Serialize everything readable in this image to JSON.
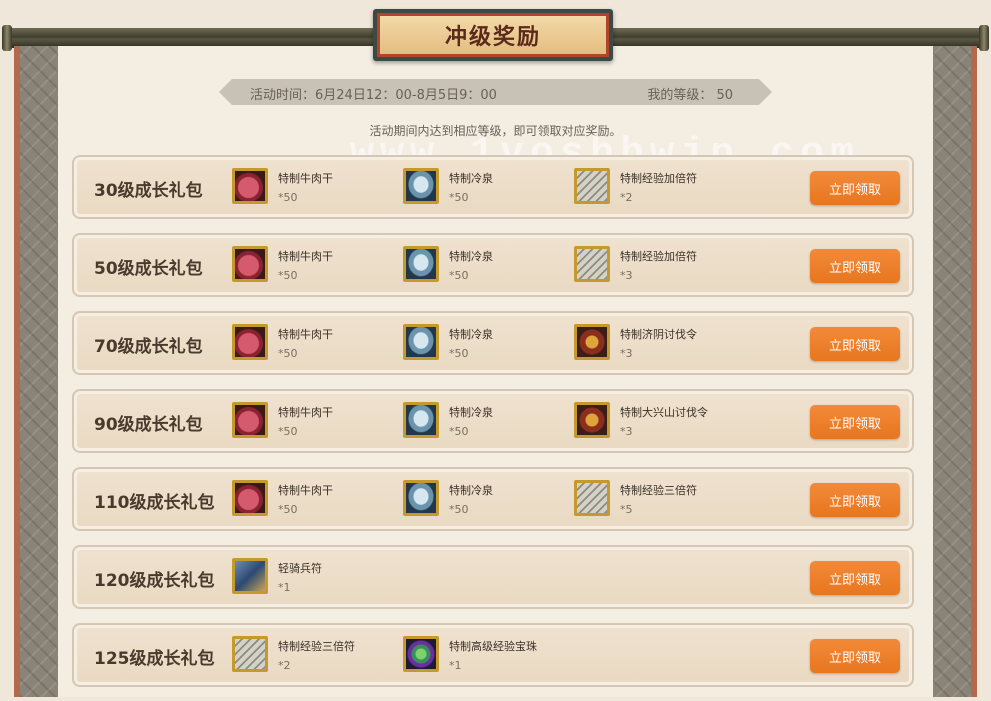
{
  "header": {
    "title": "冲级奖励"
  },
  "info": {
    "time": "活动时间：6月24日12：00-8月5日9：00",
    "level": "我的等级： 50"
  },
  "subtitle": "活动期间内达到相应等级，即可领取对应奖励。",
  "watermark": "www.1yoshbwjp.com",
  "claim_label": "立即领取",
  "rows": [
    {
      "title": "30级成长礼包",
      "rewards": [
        {
          "icon": "beef-jerky-icon",
          "name": "特制牛肉干",
          "qty": "*50"
        },
        {
          "icon": "cold-spring-icon",
          "name": "特制冷泉",
          "qty": "*50"
        },
        {
          "icon": "exp-charm-icon",
          "name": "特制经验加倍符",
          "qty": "*2"
        }
      ]
    },
    {
      "title": "50级成长礼包",
      "rewards": [
        {
          "icon": "beef-jerky-icon",
          "name": "特制牛肉干",
          "qty": "*50"
        },
        {
          "icon": "cold-spring-icon",
          "name": "特制冷泉",
          "qty": "*50"
        },
        {
          "icon": "exp-charm-icon",
          "name": "特制经验加倍符",
          "qty": "*3"
        }
      ]
    },
    {
      "title": "70级成长礼包",
      "rewards": [
        {
          "icon": "beef-jerky-icon",
          "name": "特制牛肉干",
          "qty": "*50"
        },
        {
          "icon": "cold-spring-icon",
          "name": "特制冷泉",
          "qty": "*50"
        },
        {
          "icon": "war-order-icon",
          "name": "特制济阴讨伐令",
          "qty": "*3"
        }
      ]
    },
    {
      "title": "90级成长礼包",
      "rewards": [
        {
          "icon": "beef-jerky-icon",
          "name": "特制牛肉干",
          "qty": "*50"
        },
        {
          "icon": "cold-spring-icon",
          "name": "特制冷泉",
          "qty": "*50"
        },
        {
          "icon": "war-order-icon",
          "name": "特制大兴山讨伐令",
          "qty": "*3"
        }
      ]
    },
    {
      "title": "110级成长礼包",
      "rewards": [
        {
          "icon": "beef-jerky-icon",
          "name": "特制牛肉干",
          "qty": "*50"
        },
        {
          "icon": "cold-spring-icon",
          "name": "特制冷泉",
          "qty": "*50"
        },
        {
          "icon": "exp-charm-icon",
          "name": "特制经验三倍符",
          "qty": "*5"
        }
      ]
    },
    {
      "title": "120级成长礼包",
      "rewards": [
        {
          "icon": "cavalry-token-icon",
          "name": "轻骑兵符",
          "qty": "*1"
        }
      ]
    },
    {
      "title": "125级成长礼包",
      "rewards": [
        {
          "icon": "exp-charm-icon",
          "name": "特制经验三倍符",
          "qty": "*2"
        },
        {
          "icon": "exp-pearl-icon",
          "name": "特制高级经验宝珠",
          "qty": "*1"
        }
      ]
    }
  ],
  "colors": {
    "accent_button": "#e8761e",
    "title_border": "#b0452e",
    "icon_frame": "#c49a2e"
  }
}
